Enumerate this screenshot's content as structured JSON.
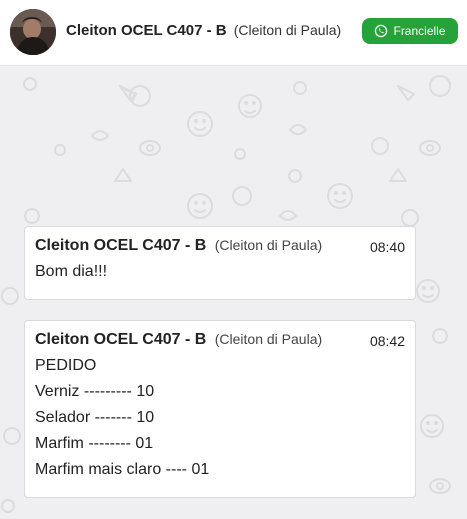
{
  "header": {
    "contact_name": "Cleiton OCEL C407 - B",
    "contact_alias": "(Cleiton di Paula)",
    "agent_button_label": "Francielle",
    "agent_icon": "whatsapp-icon",
    "avatar_icon": "contact-photo"
  },
  "colors": {
    "accent_green": "#25a33a",
    "chat_background": "#efeff1",
    "bubble_background": "#ffffff"
  },
  "messages": [
    {
      "sender": "Cleiton OCEL C407 - B",
      "alias": "(Cleiton di Paula)",
      "time": "08:40",
      "lines": [
        "Bom dia!!!"
      ]
    },
    {
      "sender": "Cleiton OCEL C407 - B",
      "alias": "(Cleiton di Paula)",
      "time": "08:42",
      "lines": [
        "PEDIDO",
        "Verniz --------- 10",
        "Selador ------- 10",
        "Marfim -------- 01",
        "Marfim mais claro ---- 01"
      ]
    }
  ]
}
